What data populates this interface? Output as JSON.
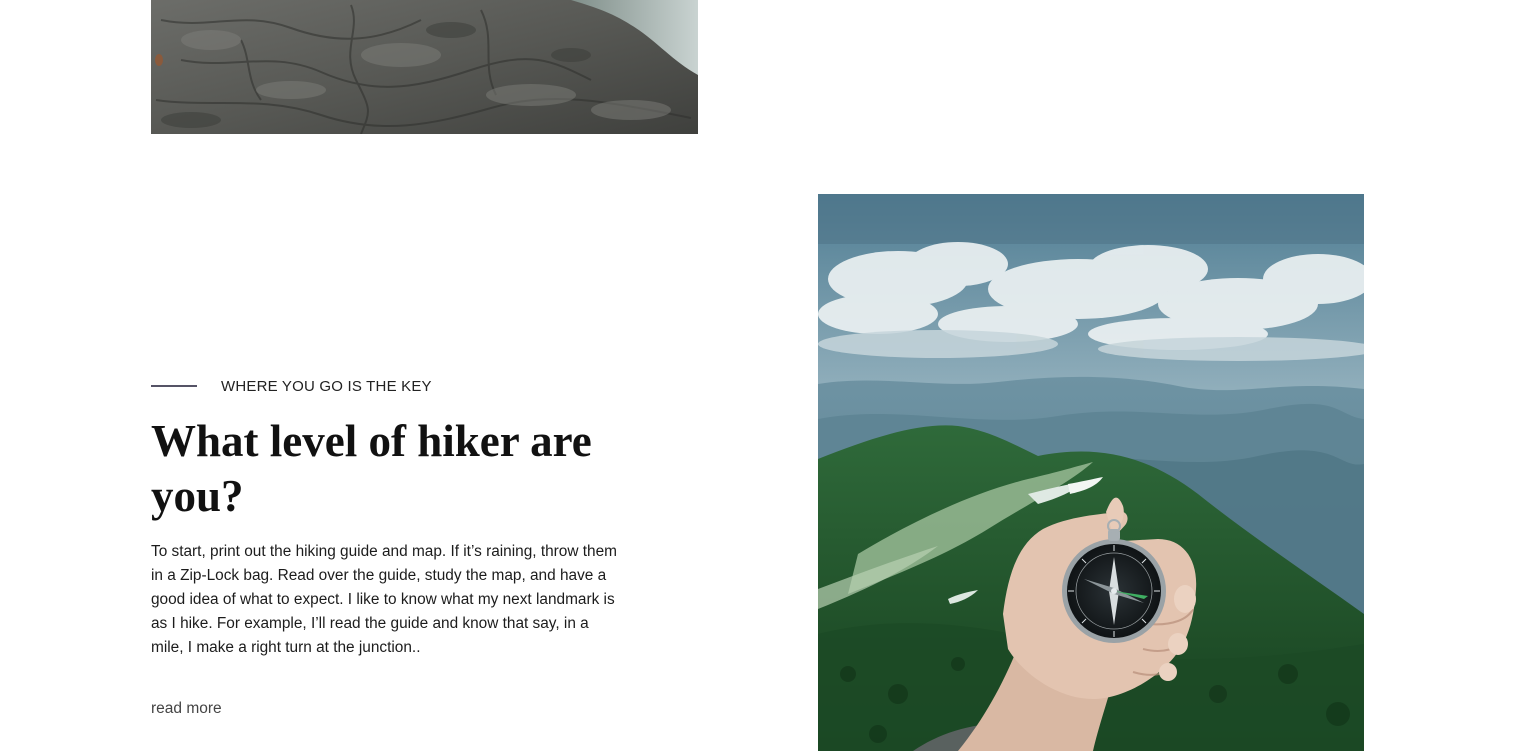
{
  "feature": {
    "eyebrow": "WHERE YOU GO IS THE KEY",
    "title": "What level of hiker are you?",
    "body": "To start, print out the hiking guide and map. If it’s raining, throw them in a Zip-Lock bag. Read over the guide, study the map, and have a good idea of what to expect. I like to know what my next landmark is as I hike. For example, I’ll read the guide and know that say, in a mile, I make a right turn at the junction..",
    "read_more_label": "read more"
  },
  "colors": {
    "accent_line": "#555366",
    "heading": "#111111",
    "body_text": "#1c1c1c"
  }
}
